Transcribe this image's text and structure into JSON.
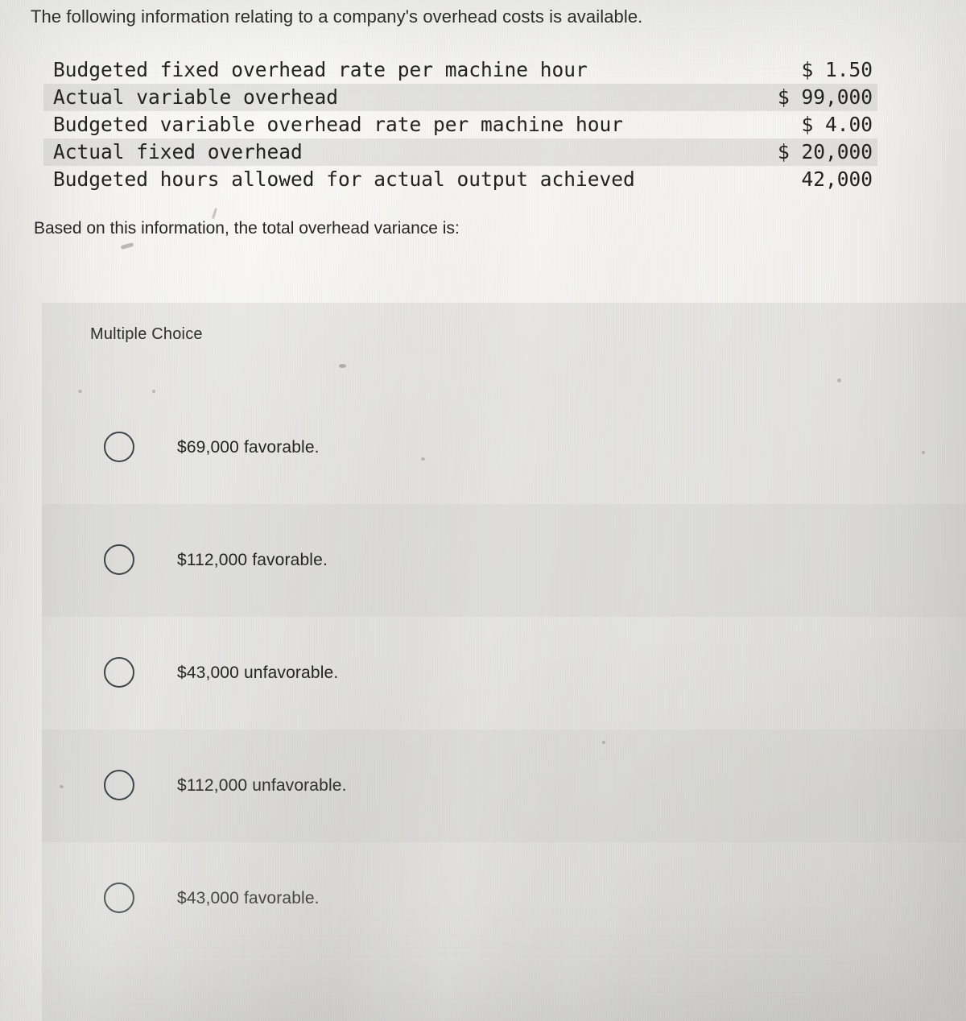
{
  "stem": {
    "intro": "The following information relating to a company's overhead costs is available.",
    "prompt": "Based on this information, the total overhead variance is:"
  },
  "facts_table": {
    "rows": [
      {
        "label": "Budgeted fixed overhead rate per machine hour",
        "value": "$ 1.50",
        "shaded": false
      },
      {
        "label": "Actual variable overhead",
        "value": "$ 99,000",
        "shaded": true
      },
      {
        "label": "Budgeted variable overhead rate per machine hour",
        "value": "$ 4.00",
        "shaded": false
      },
      {
        "label": "Actual fixed overhead",
        "value": "$ 20,000",
        "shaded": true
      },
      {
        "label": "Budgeted hours allowed for actual output achieved",
        "value": "42,000",
        "shaded": false
      }
    ]
  },
  "answer_panel": {
    "heading": "Multiple Choice",
    "options": [
      {
        "label": "$69,000 favorable.",
        "selected": false
      },
      {
        "label": "$112,000 favorable.",
        "selected": false
      },
      {
        "label": "$43,000 unfavorable.",
        "selected": false
      },
      {
        "label": "$112,000 unfavorable.",
        "selected": false
      },
      {
        "label": "$43,000 favorable.",
        "selected": false
      }
    ]
  },
  "colors": {
    "paper": "#e9e8e4",
    "text": "#262626",
    "panel_fill": "#b0b0ac",
    "radio_border": "#40444a",
    "row_shade": "#989896"
  }
}
